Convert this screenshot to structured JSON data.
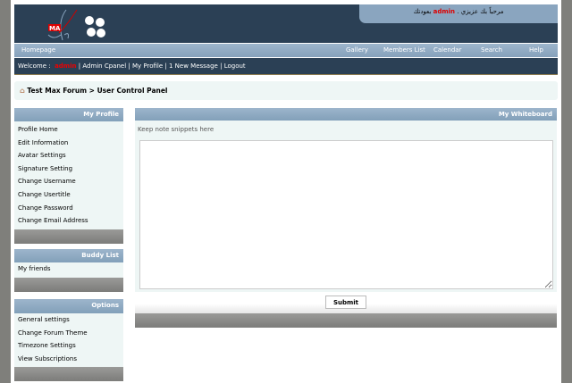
{
  "header": {
    "logo_text": "MA",
    "welcome_ar_pre": "بعودتك",
    "welcome_ar_user": "admin",
    "welcome_ar_post": "مرحباً بك عزيزي ."
  },
  "nav": {
    "home": "Homepage",
    "items": [
      "Gallery",
      "Members List",
      "Calendar",
      "Search",
      "Help"
    ]
  },
  "userbar": {
    "welcome": "Welcome :",
    "user": "admin",
    "links": [
      "Admin Cpanel",
      "My Profile",
      "1 New Message",
      "Logout"
    ],
    "sep": "|"
  },
  "breadcrumb": {
    "forum": "Test Max Forum",
    "sep": ">",
    "page": "User Control Panel"
  },
  "sidebar": {
    "profile": {
      "title": "My Profile",
      "items": [
        "Profile Home",
        "Edit Information",
        "Avatar Settings",
        "Signature Setting",
        "Change Username",
        "Change Usertitle",
        "Change Password",
        "Change Email Address"
      ]
    },
    "buddy": {
      "title": "Buddy List",
      "items": [
        "My friends"
      ]
    },
    "options": {
      "title": "Options",
      "items": [
        "General settings",
        "Change Forum Theme",
        "Timezone Settings",
        "View Subscriptions"
      ]
    }
  },
  "main": {
    "title": "My Whiteboard",
    "hint": "Keep note snippets here",
    "note_value": "",
    "submit": "Submit"
  }
}
